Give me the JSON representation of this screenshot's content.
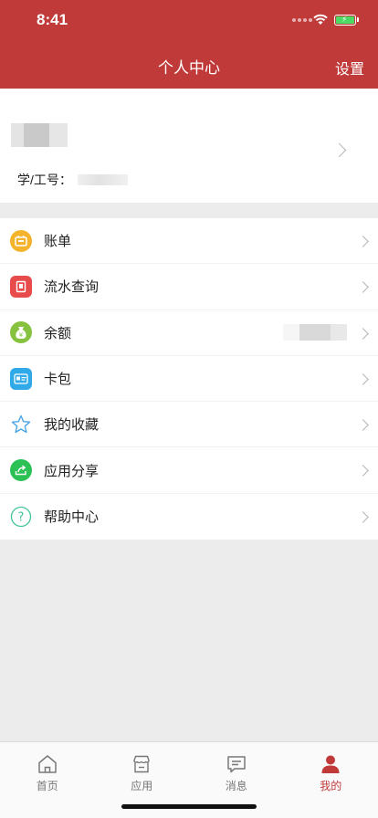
{
  "status_bar": {
    "time": "8:41"
  },
  "header": {
    "title": "个人中心",
    "settings_label": "设置"
  },
  "profile": {
    "id_label": "学/工号："
  },
  "menu": {
    "items": [
      {
        "label": "账单",
        "icon": "bill-icon",
        "color": "#f5b22b"
      },
      {
        "label": "流水查询",
        "icon": "transaction-icon",
        "color": "#e84b4b"
      },
      {
        "label": "余额",
        "icon": "money-bag-icon",
        "color": "#86c23f"
      },
      {
        "label": "卡包",
        "icon": "card-icon",
        "color": "#2fa9e8"
      },
      {
        "label": "我的收藏",
        "icon": "star-icon",
        "color": "#4aa6e6"
      },
      {
        "label": "应用分享",
        "icon": "share-icon",
        "color": "#2cc155"
      },
      {
        "label": "帮助中心",
        "icon": "help-icon",
        "color": "#3ec49b"
      }
    ]
  },
  "tabbar": {
    "tabs": [
      {
        "label": "首页",
        "icon": "home-icon"
      },
      {
        "label": "应用",
        "icon": "apps-icon"
      },
      {
        "label": "消息",
        "icon": "message-icon"
      },
      {
        "label": "我的",
        "icon": "person-icon",
        "active": true
      }
    ],
    "active_color": "#c13a3a"
  }
}
